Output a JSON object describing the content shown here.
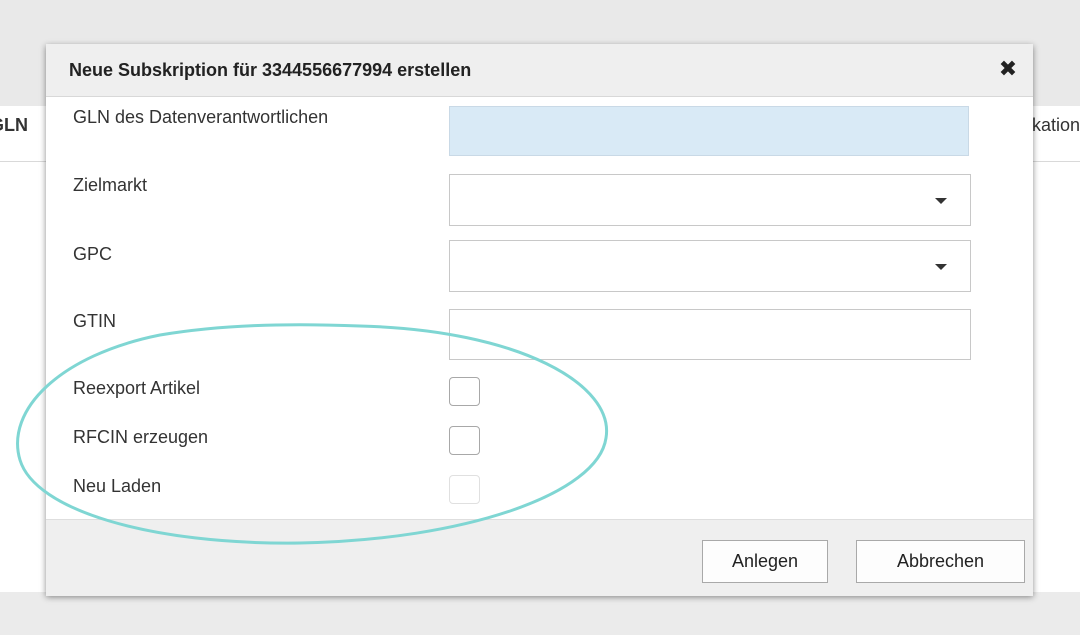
{
  "background": {
    "left_column_label": "GLN",
    "right_column_label": "kation"
  },
  "dialog": {
    "title": "Neue Subskription für 3344556677994 erstellen",
    "close_icon": "close-icon",
    "fields": {
      "gln": {
        "label": "GLN des Datenverantwortlichen",
        "value": ""
      },
      "zielmarkt": {
        "label": "Zielmarkt",
        "value": ""
      },
      "gpc": {
        "label": "GPC",
        "value": ""
      },
      "gtin": {
        "label": "GTIN",
        "value": ""
      },
      "reexport": {
        "label": "Reexport Artikel",
        "checked": false
      },
      "rfcin": {
        "label": "RFCIN erzeugen",
        "checked": false
      },
      "neu_laden": {
        "label": "Neu Laden",
        "checked": false,
        "disabled": true
      }
    },
    "buttons": {
      "create": "Anlegen",
      "cancel": "Abbrechen"
    }
  },
  "colors": {
    "highlight_ring": "#7fd6d3",
    "gln_field_bg": "#d9eaf6"
  }
}
